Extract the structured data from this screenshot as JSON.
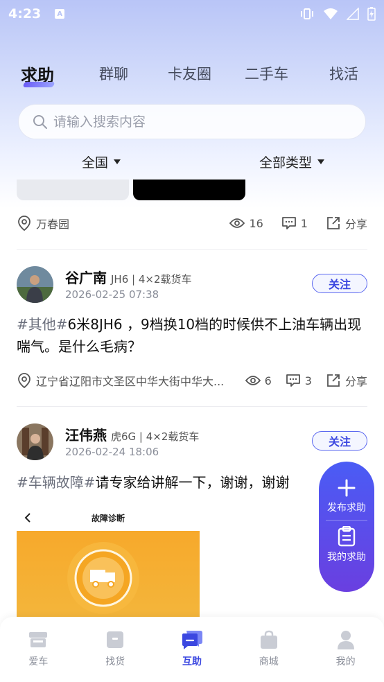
{
  "status_bar": {
    "time": "4:23",
    "notification_letter": "A"
  },
  "tabs": [
    {
      "label": "求助",
      "active": true
    },
    {
      "label": "群聊",
      "active": false
    },
    {
      "label": "卡友圈",
      "active": false
    },
    {
      "label": "二手车",
      "active": false
    },
    {
      "label": "找活",
      "active": false
    }
  ],
  "search": {
    "placeholder": "请输入搜索内容"
  },
  "filters": {
    "region": "全国",
    "type": "全部类型"
  },
  "post0": {
    "location": "万春园",
    "views": "16",
    "comments": "1",
    "share": "分享"
  },
  "post1": {
    "name": "谷广南",
    "tag": "JH6 | 4×2载货车",
    "date": "2026-02-25 07:38",
    "follow": "关注",
    "hashtag": "#其他#",
    "text": "6米8JH6 ，9档换10档的时候供不上油车辆出现喘气。是什么毛病？",
    "location": "辽宁省辽阳市文圣区中华大街中华大...",
    "views": "6",
    "comments": "3",
    "share": "分享"
  },
  "post2": {
    "name": "汪伟燕",
    "tag": "虎6G | 4×2载货车",
    "date": "2026-02-24 18:06",
    "follow": "关注",
    "hashtag": "#车辆故障#",
    "text": "请专家给讲解一下，谢谢，谢谢",
    "image_title": "故障诊断"
  },
  "fab": {
    "publish": "发布求助",
    "mine": "我的求助"
  },
  "bottom_nav": [
    {
      "label": "爱车",
      "icon": "truck-icon",
      "active": false
    },
    {
      "label": "找货",
      "icon": "cargo-box-icon",
      "active": false
    },
    {
      "label": "互助",
      "icon": "chat-bubbles-icon",
      "active": true
    },
    {
      "label": "商城",
      "icon": "shopping-bag-icon",
      "active": false
    },
    {
      "label": "我的",
      "icon": "person-icon",
      "active": false
    }
  ],
  "colors": {
    "accent": "#3b47e0",
    "fab_top": "#4a5cf5",
    "fab_bottom": "#6a3fe0"
  }
}
